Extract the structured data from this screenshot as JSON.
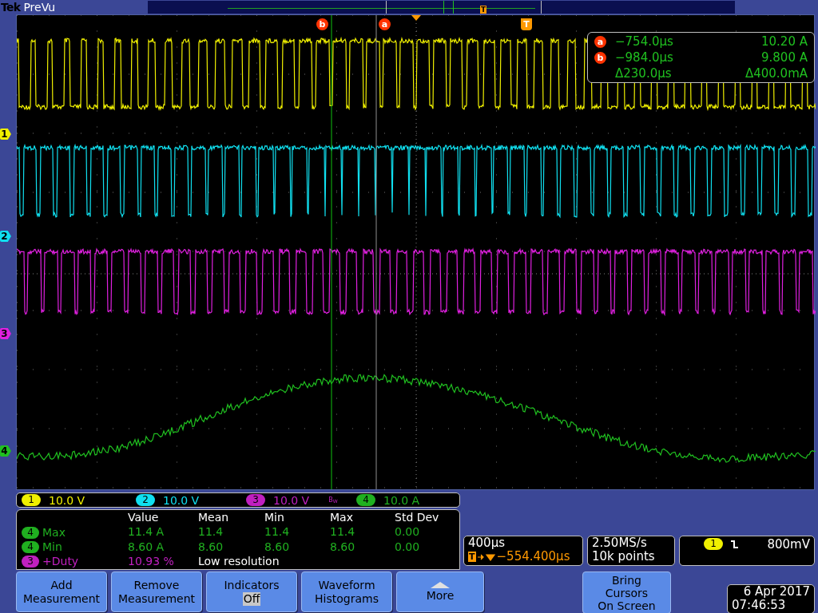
{
  "header": {
    "brand": "Tek",
    "mode": "PreVu",
    "trigger_tag": "T"
  },
  "cursor_markers": [
    {
      "label": "b",
      "color": "#ff3300"
    },
    {
      "label": "a",
      "color": "#ff3300"
    }
  ],
  "trigger_marker": {
    "label": "T"
  },
  "cursor_readout": [
    {
      "marker": "a",
      "time": "−754.0µs",
      "value": "10.20 A"
    },
    {
      "marker": "b",
      "time": "−984.0µs",
      "value": "9.800 A"
    },
    {
      "time": "Δ230.0µs",
      "value": "Δ400.0mA"
    }
  ],
  "waveforms": [
    {
      "channel": "1",
      "color": "#f0f000",
      "kind": "pulse"
    },
    {
      "channel": "2",
      "color": "#10e0f0",
      "kind": "pulse"
    },
    {
      "channel": "3",
      "color": "#e020e0",
      "kind": "pulse"
    },
    {
      "channel": "4",
      "color": "#20c020",
      "kind": "analog"
    }
  ],
  "channels": [
    {
      "number": "1",
      "color": "#f0f000",
      "scale": "10.0 V"
    },
    {
      "number": "2",
      "color": "#10e0f0",
      "scale": "10.0 V"
    },
    {
      "number": "3",
      "color": "#c020c0",
      "scale": "10.0 V",
      "bw_label": "B$_{W}$"
    },
    {
      "number": "4",
      "color": "#20b020",
      "scale": "10.0 A"
    }
  ],
  "measurements": {
    "columns": [
      "Value",
      "Mean",
      "Min",
      "Max",
      "Std Dev"
    ],
    "rows": [
      {
        "channel": "4",
        "color": "#20b020",
        "name": "Max",
        "values": [
          "11.4 A",
          "11.4",
          "11.4",
          "11.4",
          "0.00"
        ]
      },
      {
        "channel": "4",
        "color": "#20b020",
        "name": "Min",
        "values": [
          "8.60 A",
          "8.60",
          "8.60",
          "8.60",
          "0.00"
        ]
      },
      {
        "channel": "3",
        "color": "#c020c0",
        "name": "+Duty",
        "values": [
          "10.93 %"
        ],
        "note": "Low resolution"
      }
    ]
  },
  "timebase": {
    "scale": "400µs",
    "trigger_tag": "T",
    "trigger_position": "−554.400µs"
  },
  "acquisition": {
    "sample_rate": "2.50MS/s",
    "record_length": "10k points"
  },
  "trigger": {
    "source": "1",
    "level": "800mV"
  },
  "buttons": [
    {
      "kind": "plain",
      "lines": [
        "Add",
        "Measurement"
      ]
    },
    {
      "kind": "plain",
      "lines": [
        "Remove",
        "Measurement"
      ]
    },
    {
      "kind": "value",
      "lines": [
        "Indicators"
      ],
      "value": "Off"
    },
    {
      "kind": "plain",
      "lines": [
        "Waveform",
        "Histograms"
      ]
    },
    {
      "kind": "more",
      "lines": [
        "More"
      ]
    }
  ],
  "side_button": {
    "lines": [
      "Bring",
      "Cursors",
      "On Screen"
    ]
  },
  "clock": {
    "date": "6 Apr 2017",
    "time": "07:46:53"
  }
}
